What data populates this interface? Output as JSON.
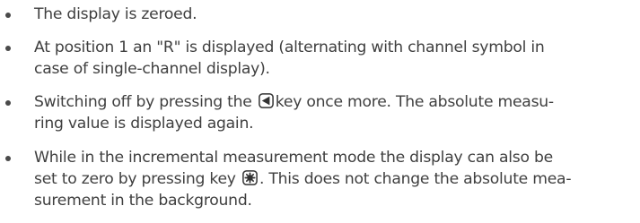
{
  "bullets": [
    {
      "lines": [
        {
          "text": "The display is zeroed."
        }
      ]
    },
    {
      "lines": [
        {
          "text": "At position 1 an \"R\" is displayed (alternating with channel symbol in"
        },
        {
          "text": "case of single-channel display)."
        }
      ]
    },
    {
      "lines": [
        {
          "before": "Switching off by pressing the",
          "icon": "left-arrow-key-icon",
          "after": "key once more. The absolute measu-"
        },
        {
          "text": "ring value is displayed again."
        }
      ]
    },
    {
      "lines": [
        {
          "text": "While in the incremental measurement mode the display can also be"
        },
        {
          "before": "set to zero by pressing key",
          "icon": "asterisk-key-icon",
          "after": ". This does not change the absolute mea-"
        },
        {
          "text": "surement in the background."
        }
      ]
    }
  ],
  "colors": {
    "text": "#3f3f3f",
    "bullet": "#4a4a4a",
    "key_outline": "#333333"
  }
}
